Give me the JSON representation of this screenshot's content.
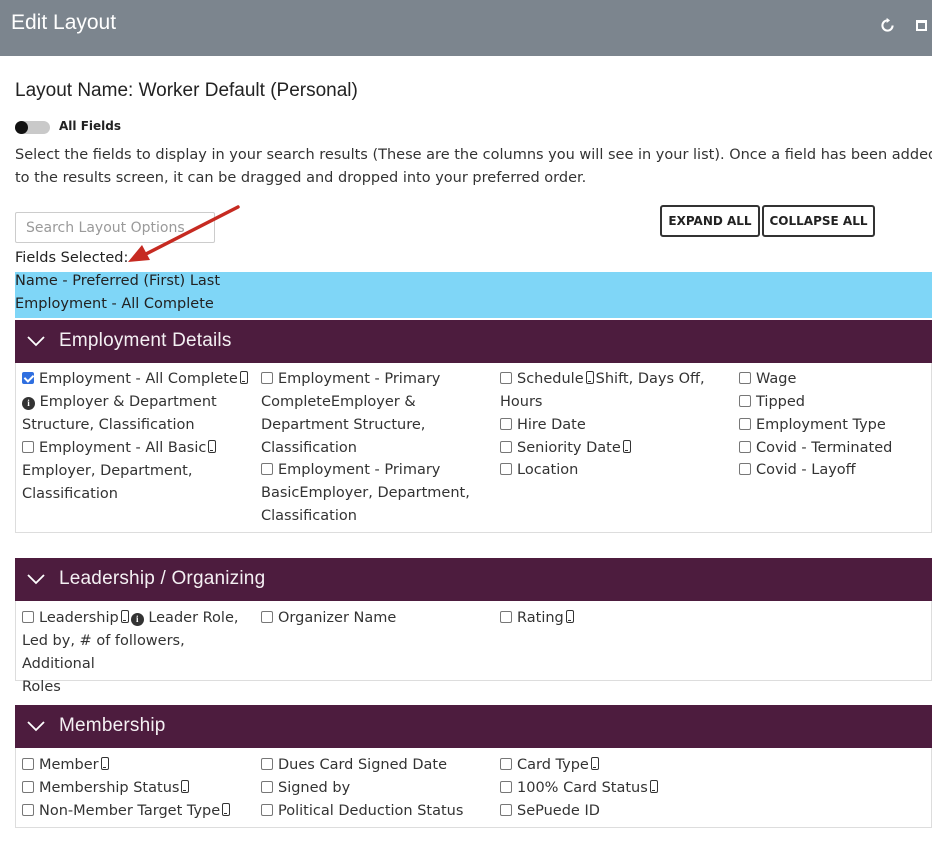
{
  "window": {
    "title": "Edit Layout"
  },
  "layout_name": "Layout Name: Worker Default (Personal)",
  "toggle": {
    "label": "All Fields",
    "on": false
  },
  "instructions": "Select the fields to display in your search results (These are the columns you will see in your list). Once a field has been added to the results screen, it can be dragged and dropped into your preferred order.",
  "search": {
    "placeholder": "Search Layout Options",
    "value": ""
  },
  "buttons": {
    "expand_all": "EXPAND ALL",
    "collapse_all": "COLLAPSE ALL"
  },
  "fields_selected": {
    "label": "Fields Selected:",
    "items": [
      "Name - Preferred (First) Last",
      "Employment - All Complete"
    ]
  },
  "sections": [
    {
      "title": "Employment Details",
      "fields": [
        {
          "lines": [
            "Employment - All Complete",
            "Employer & Department",
            "Structure, Classification"
          ],
          "checked": true,
          "mobile": true,
          "info": true
        },
        {
          "lines": [
            "Employment - All Basic",
            "Employer, Department,",
            "Classification"
          ],
          "checked": false,
          "mobile": true,
          "info": false
        },
        {
          "lines": [
            "Employment - Primary",
            "CompleteEmployer &",
            "Department Structure,",
            "Classification"
          ],
          "checked": false,
          "mobile": false,
          "info": false
        },
        {
          "lines": [
            "Employment - Primary",
            "BasicEmployer, Department,",
            "Classification"
          ],
          "checked": false,
          "mobile": false,
          "info": false
        },
        {
          "lines": [
            "Schedule",
            "Shift, Days Off,",
            "Hours"
          ],
          "checked": false,
          "mobile": true,
          "info": false
        },
        {
          "lines": [
            "Hire Date"
          ],
          "checked": false,
          "mobile": false,
          "info": false
        },
        {
          "lines": [
            "Seniority Date"
          ],
          "checked": false,
          "mobile": true,
          "info": false
        },
        {
          "lines": [
            "Location"
          ],
          "checked": false,
          "mobile": false,
          "info": false
        },
        {
          "lines": [
            "Wage"
          ],
          "checked": false,
          "mobile": false,
          "info": false
        },
        {
          "lines": [
            "Tipped"
          ],
          "checked": false,
          "mobile": false,
          "info": false
        },
        {
          "lines": [
            "Employment Type"
          ],
          "checked": false,
          "mobile": false,
          "info": false
        },
        {
          "lines": [
            "Covid - Terminated"
          ],
          "checked": false,
          "mobile": false,
          "info": false
        },
        {
          "lines": [
            "Covid - Layoff"
          ],
          "checked": false,
          "mobile": false,
          "info": false
        }
      ]
    },
    {
      "title": "Leadership / Organizing",
      "fields": [
        {
          "lines": [
            "Leadership",
            "Leader Role,",
            "Led by, # of followers, Additional",
            "Roles"
          ],
          "checked": false,
          "mobile": true,
          "info": true
        },
        {
          "lines": [
            "Organizer Name"
          ],
          "checked": false,
          "mobile": false,
          "info": false
        },
        {
          "lines": [
            "Rating"
          ],
          "checked": false,
          "mobile": true,
          "info": false
        }
      ]
    },
    {
      "title": "Membership",
      "fields": [
        {
          "lines": [
            "Member"
          ],
          "checked": false,
          "mobile": true,
          "info": false
        },
        {
          "lines": [
            "Membership Status"
          ],
          "checked": false,
          "mobile": true,
          "info": false
        },
        {
          "lines": [
            "Non-Member Target Type"
          ],
          "checked": false,
          "mobile": true,
          "info": false
        },
        {
          "lines": [
            "Dues Card Signed Date"
          ],
          "checked": false,
          "mobile": false,
          "info": false
        },
        {
          "lines": [
            "Signed by"
          ],
          "checked": false,
          "mobile": false,
          "info": false
        },
        {
          "lines": [
            "Political Deduction Status"
          ],
          "checked": false,
          "mobile": false,
          "info": false
        },
        {
          "lines": [
            "Card Type"
          ],
          "checked": false,
          "mobile": true,
          "info": false
        },
        {
          "lines": [
            "100% Card Status"
          ],
          "checked": false,
          "mobile": true,
          "info": false
        },
        {
          "lines": [
            "SePuede ID"
          ],
          "checked": false,
          "mobile": false,
          "info": false
        }
      ]
    }
  ],
  "colors": {
    "titlebar": "#7c858e",
    "section_header": "#4d1c3e",
    "selected_bg": "#7fd6f7",
    "annotation_arrow": "#c62a21"
  }
}
